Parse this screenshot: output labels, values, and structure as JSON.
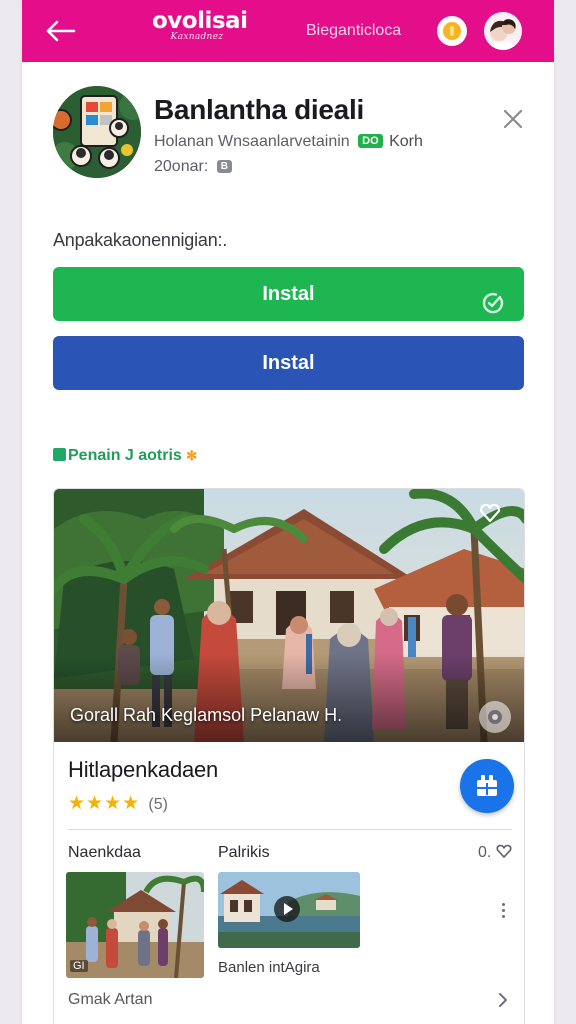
{
  "topbar": {
    "back_label": "←",
    "logo_main": "ovolisai",
    "logo_sub": "Kaxnadnez",
    "link_text": "Bieganticloca"
  },
  "app": {
    "title": "Banlantha dieali",
    "developer": "Holanan Wnsaanlarvetainin",
    "tag_badge": "DO",
    "tag_text": "Korh",
    "meta": "20onar:",
    "age_badge": "B"
  },
  "prompt": "Anpakakaonennigian:.",
  "buttons": {
    "primary": "Instal",
    "secondary": "Instal"
  },
  "section": {
    "label": "Penain J aotris"
  },
  "card": {
    "hero_caption": "Gorall Rah Keglamsol Pelanaw H.",
    "title": "Hitlapenkadaen",
    "stars": "★★★★",
    "rating_count": "(5)",
    "col_left": "Naenkdaa",
    "col_right": "Palrikis",
    "count": "0.",
    "thumb1_tag": "GI",
    "thumb2_caption": "Banlen intAgira",
    "footer_link": "Gmak Artan"
  },
  "colors": {
    "brand": "#e50e8a",
    "install_green": "#1eb651",
    "install_blue": "#2a54b5",
    "fab_blue": "#1a73e8",
    "star": "#f5b301"
  },
  "icons": [
    "back-arrow-icon",
    "coin-icon",
    "profile-avatar",
    "close-icon",
    "check-circle-icon",
    "favorite-icon",
    "more-icon",
    "share-icon",
    "heart-icon",
    "play-icon",
    "kebab-icon",
    "chevron-right-icon"
  ]
}
